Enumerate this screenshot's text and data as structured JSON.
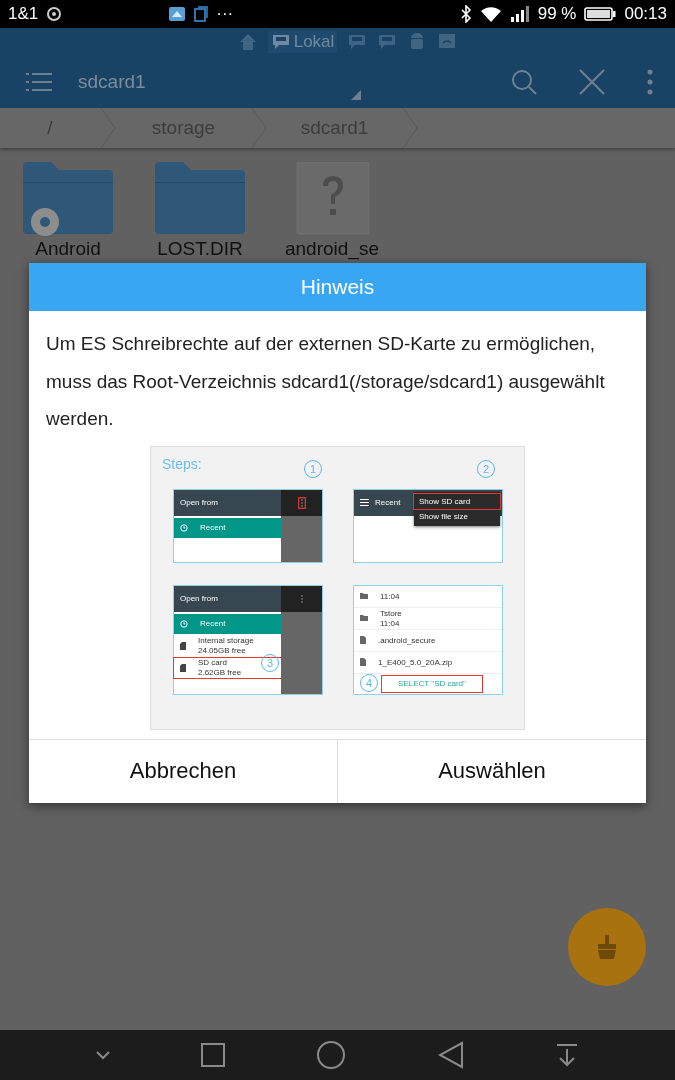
{
  "status_bar": {
    "carrier": "1&1",
    "overflow": "···",
    "battery": "99 %",
    "time": "00:13"
  },
  "app_bar": {
    "location_tabs": [
      {
        "kind": "home",
        "selected": false
      },
      {
        "kind": "sd",
        "label": "Lokal",
        "selected": true
      },
      {
        "kind": "sd",
        "selected": false
      },
      {
        "kind": "sd",
        "selected": false
      },
      {
        "kind": "android",
        "selected": false
      },
      {
        "kind": "network",
        "selected": false
      }
    ],
    "title": "sdcard1"
  },
  "breadcrumb": [
    "/",
    "storage",
    "sdcard1"
  ],
  "files": [
    {
      "name": "Android",
      "kind": "system_folder"
    },
    {
      "name": "LOST.DIR",
      "kind": "folder"
    },
    {
      "name": "android_se",
      "kind": "unknown"
    }
  ],
  "dialog": {
    "title": "Hinweis",
    "message": "Um ES Schreibrechte auf der externen SD-Karte zu ermöglichen, muss das Root-Verzeichnis sdcard1(/storage/sdcard1) ausgewählt werden.",
    "steps_image": {
      "heading": "Steps:",
      "panels": [
        {
          "kind": "drawer",
          "number": "1",
          "title": "Open from",
          "menu_marked": true,
          "rows": [
            {
              "label": "Recent",
              "selected": true,
              "marked": false
            }
          ]
        },
        {
          "kind": "menu",
          "number": "2",
          "title": "Recent",
          "menu_items": [
            {
              "label": "Show SD card",
              "marked": true
            },
            {
              "label": "Show file size",
              "marked": false
            }
          ]
        },
        {
          "kind": "drawer",
          "number": "3",
          "title": "Open from",
          "menu_marked": false,
          "rows": [
            {
              "label": "Recent",
              "selected": true,
              "marked": false
            },
            {
              "label": "Internal storage",
              "detail": "24.05GB free",
              "selected": false,
              "marked": false
            },
            {
              "label": "SD card",
              "detail": "2.62GB free",
              "selected": false,
              "marked": true
            }
          ]
        },
        {
          "kind": "file_list",
          "number": "4",
          "files": [
            {
              "detail": "11:04",
              "kind": "folder"
            },
            {
              "label": "Tstore",
              "detail": "11:04",
              "kind": "folder"
            },
            {
              "label": ".android_secure",
              "kind": "file"
            },
            {
              "label": "1_E400_5.0_20A.zip",
              "kind": "file"
            }
          ],
          "action": "SELECT \"SD card\""
        }
      ]
    },
    "buttons": [
      "Abbrechen",
      "Auswählen"
    ]
  }
}
